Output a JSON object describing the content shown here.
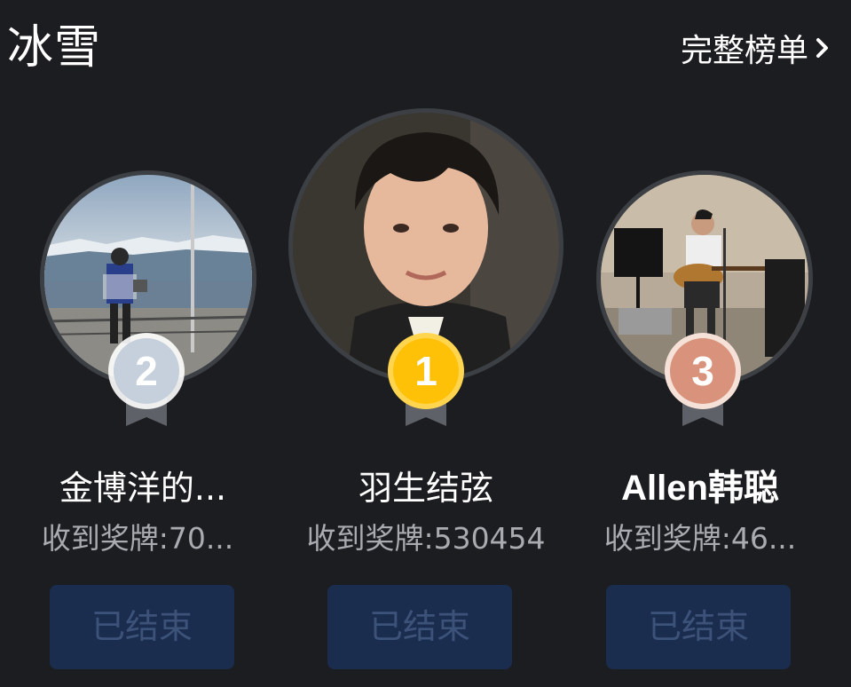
{
  "header": {
    "title": "冰雪",
    "more_label": "完整榜单"
  },
  "ranking": [
    {
      "rank": "2",
      "name": "金博洋的...",
      "medal_text": "收到奖牌:70...",
      "status": "已结束",
      "medal_color": "#c5d0dc"
    },
    {
      "rank": "1",
      "name": "羽生结弦",
      "medal_text": "收到奖牌:530454",
      "status": "已结束",
      "medal_color": "#ffc107"
    },
    {
      "rank": "3",
      "name": "Allen韩聪",
      "medal_text": "收到奖牌:46...",
      "status": "已结束",
      "medal_color": "#d9937c"
    }
  ],
  "colors": {
    "background": "#1c1d20",
    "button_bg": "#1b2d4f",
    "button_text": "#3c5279",
    "secondary_text": "#a9abb0"
  },
  "icons": {
    "more": "chevron-right-icon",
    "ribbon": "ribbon-icon"
  }
}
